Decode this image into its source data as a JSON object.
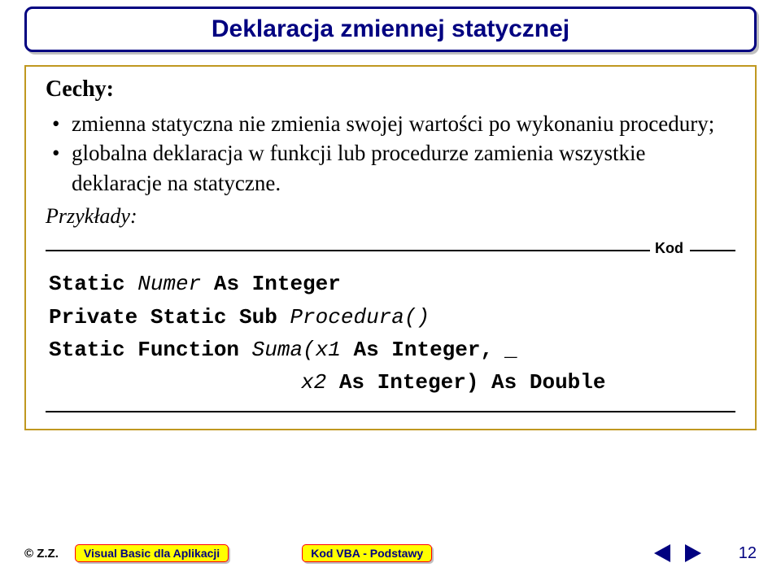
{
  "title": "Deklaracja zmiennej statycznej",
  "cechy_label": "Cechy:",
  "bullets": [
    "zmienna statyczna nie zmienia swojej wartości po wykonaniu procedury;",
    "globalna deklaracja w funkcji lub procedurze zamienia wszystkie deklaracje na statyczne."
  ],
  "przyklady_label": "Przykłady:",
  "kod_label": "Kod",
  "code": {
    "l1_kw1": "Static ",
    "l1_id": "Numer",
    "l1_kw2": " As Integer",
    "l2_kw1": "Private Static Sub ",
    "l2_id": "Procedura()",
    "l3_kw1": "Static Function ",
    "l3_id1": "Suma(x1",
    "l3_kw2": " As Integer, ",
    "l3_cont": "_",
    "l4_id": "x2",
    "l4_kw": " As Integer) As Double"
  },
  "footer": {
    "copyright": "© Z.Z.",
    "pill1": "Visual Basic dla Aplikacji",
    "pill2": "Kod VBA - Podstawy",
    "page": "12"
  }
}
